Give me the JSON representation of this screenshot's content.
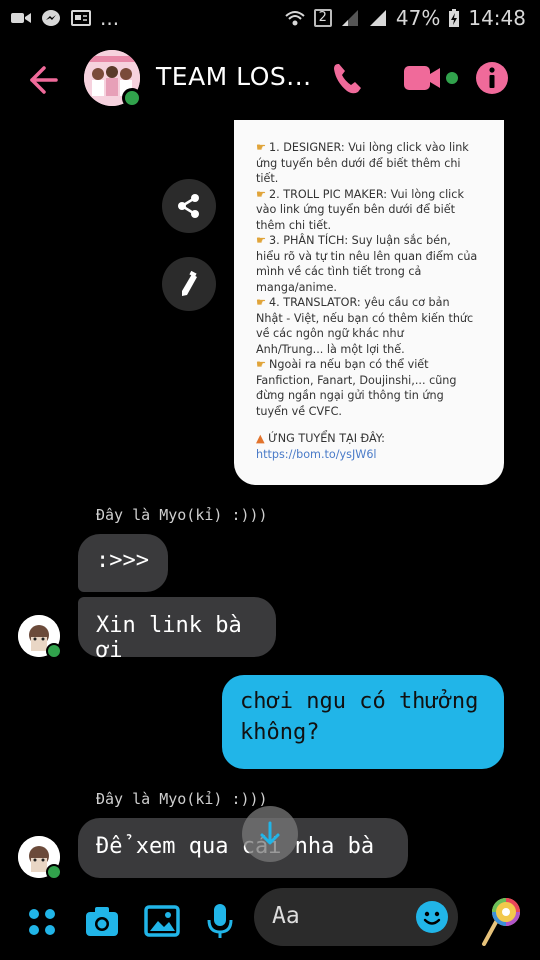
{
  "status_bar": {
    "battery_percent": "47%",
    "time": "14:48",
    "sim_slot": "2",
    "overflow": "..."
  },
  "header": {
    "title": "TEAM LOS...",
    "accent_color": "#f06a9a"
  },
  "shared_image": {
    "lines": [
      {
        "text": "1. DESIGNER: Vui lòng click vào link",
        "pointer": true
      },
      {
        "text": "ứng tuyển bên dưới để biết thêm chi",
        "pointer": false
      },
      {
        "text": "tiết.",
        "pointer": false
      },
      {
        "text": "2. TROLL PIC MAKER: Vui lòng click",
        "pointer": true
      },
      {
        "text": "vào link ứng tuyển bên dưới để biết",
        "pointer": false
      },
      {
        "text": "thêm chi tiết.",
        "pointer": false
      },
      {
        "text": "3. PHÂN TÍCH: Suy luận sắc bén,",
        "pointer": true
      },
      {
        "text": "hiểu rõ và tự tin nêu lên quan điểm của",
        "pointer": false
      },
      {
        "text": "mình về các tình tiết trong cả",
        "pointer": false
      },
      {
        "text": "manga/anime.",
        "pointer": false
      },
      {
        "text": "4. TRANSLATOR: yêu cầu cơ bản",
        "pointer": true
      },
      {
        "text": "Nhật - Việt, nếu bạn có thêm kiến thức",
        "pointer": false
      },
      {
        "text": "về các ngôn ngữ khác như",
        "pointer": false
      },
      {
        "text": "Anh/Trung... là một lợi thế.",
        "pointer": false
      },
      {
        "text": "Ngoài ra nếu bạn có thể viết",
        "pointer": true
      },
      {
        "text": "Fanfiction, Fanart, Doujinshi,... cũng",
        "pointer": false
      },
      {
        "text": "đừng ngần ngại gửi thông tin ứng",
        "pointer": false
      },
      {
        "text": "tuyển về CVFC.",
        "pointer": false
      }
    ],
    "apply_label": "ỨNG TUYỂN TẠI ĐÂY:",
    "apply_link": "https://bom.to/ysJW6l"
  },
  "messages": {
    "sender_1": "Đây là Myo(kỉ) :)))",
    "msg_1": ":>>>",
    "msg_2": "Xin link bà ơi",
    "mine_line_1": "chơi ngu có thưởng",
    "mine_line_2": "không?",
    "sender_2": "Đây là Myo(kỉ) :)))",
    "msg_3": "Để xem qua cái nha bà"
  },
  "composer": {
    "placeholder": "Aa"
  },
  "colors": {
    "accent_pink": "#f06a9a",
    "my_bubble": "#21b5e8",
    "their_bubble": "#3a3a3c",
    "online_green": "#31a24c"
  }
}
